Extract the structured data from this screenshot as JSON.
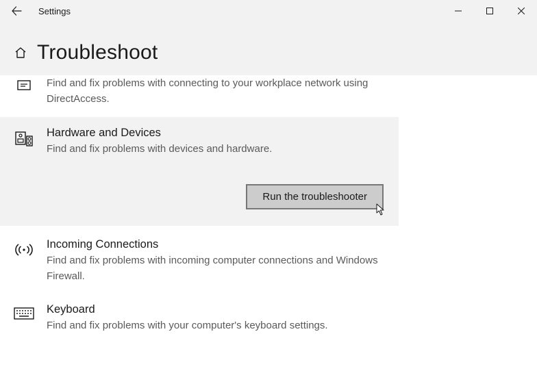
{
  "window": {
    "title": "Settings"
  },
  "page": {
    "heading": "Troubleshoot"
  },
  "items": {
    "partial_top": {
      "desc": "Find and fix problems with connecting to your workplace network using DirectAccess."
    },
    "hardware": {
      "title": "Hardware and Devices",
      "desc": "Find and fix problems with devices and hardware.",
      "button": "Run the troubleshooter"
    },
    "incoming": {
      "title": "Incoming Connections",
      "desc": "Find and fix problems with incoming computer connections and Windows Firewall."
    },
    "keyboard": {
      "title": "Keyboard",
      "desc": "Find and fix problems with your computer's keyboard settings."
    }
  }
}
